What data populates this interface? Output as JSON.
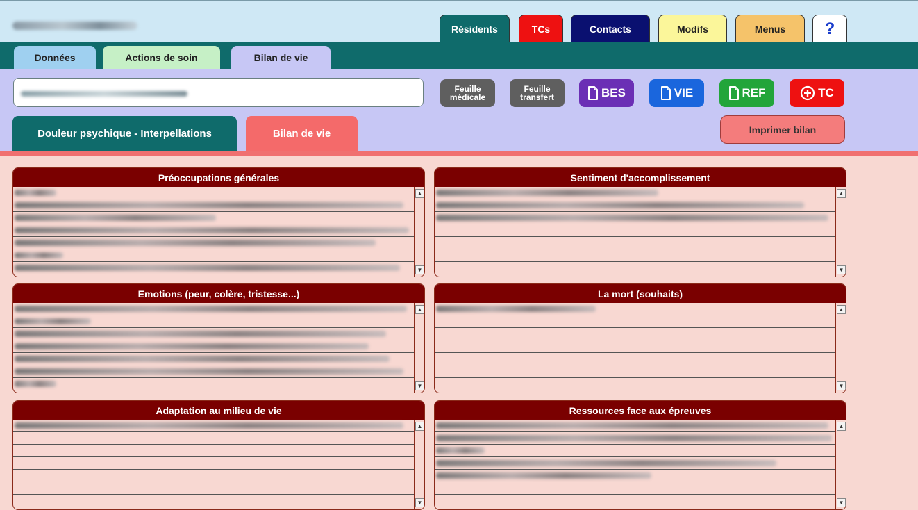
{
  "topnav": {
    "tabs": [
      {
        "label": "Résidents",
        "bg": "#0f6b6b",
        "color": "#ffffff"
      },
      {
        "label": "TCs",
        "bg": "#ee1111",
        "color": "#ffffff"
      },
      {
        "label": "Contacts",
        "bg": "#0a1070",
        "color": "#ffffff"
      },
      {
        "label": "Modifs",
        "bg": "#fbf69a",
        "color": "#222222"
      },
      {
        "label": "Menus",
        "bg": "#f5c36a",
        "color": "#222222"
      }
    ],
    "help": "?"
  },
  "subtabs": [
    {
      "label": "Données",
      "bg": "#9fd0f0"
    },
    {
      "label": "Actions de soin",
      "bg": "#c6f0c6"
    },
    {
      "label": "Bilan de vie",
      "bg": "#c7c7f5"
    }
  ],
  "doc_buttons": {
    "feuille_medicale": "Feuille\nmédicale",
    "feuille_transfert": "Feuille\ntransfert",
    "bes": "BES",
    "vie": "VIE",
    "ref": "REF",
    "tc": "TC"
  },
  "section_tabs": [
    "Douleur psychique - Interpellations",
    "Bilan de vie"
  ],
  "print_button": "Imprimer bilan",
  "panels": [
    {
      "title": "Préoccupations générales"
    },
    {
      "title": "Sentiment d'accomplissement"
    },
    {
      "title": "Emotions (peur, colère, tristesse...)"
    },
    {
      "title": "La mort (souhaits)"
    },
    {
      "title": "Adaptation au milieu de vie"
    },
    {
      "title": "Ressources face aux épreuves"
    }
  ],
  "colors": {
    "teal": "#0f6b6b",
    "panel_header": "#7a0000",
    "panel_bg": "#f8d8d2",
    "bilan_tab": "#f46a6a",
    "grey_button": "#5f5f5f",
    "bes": "#6b2fb5",
    "vie": "#1a66dd",
    "ref": "#22a53a",
    "tc": "#ee1111"
  }
}
